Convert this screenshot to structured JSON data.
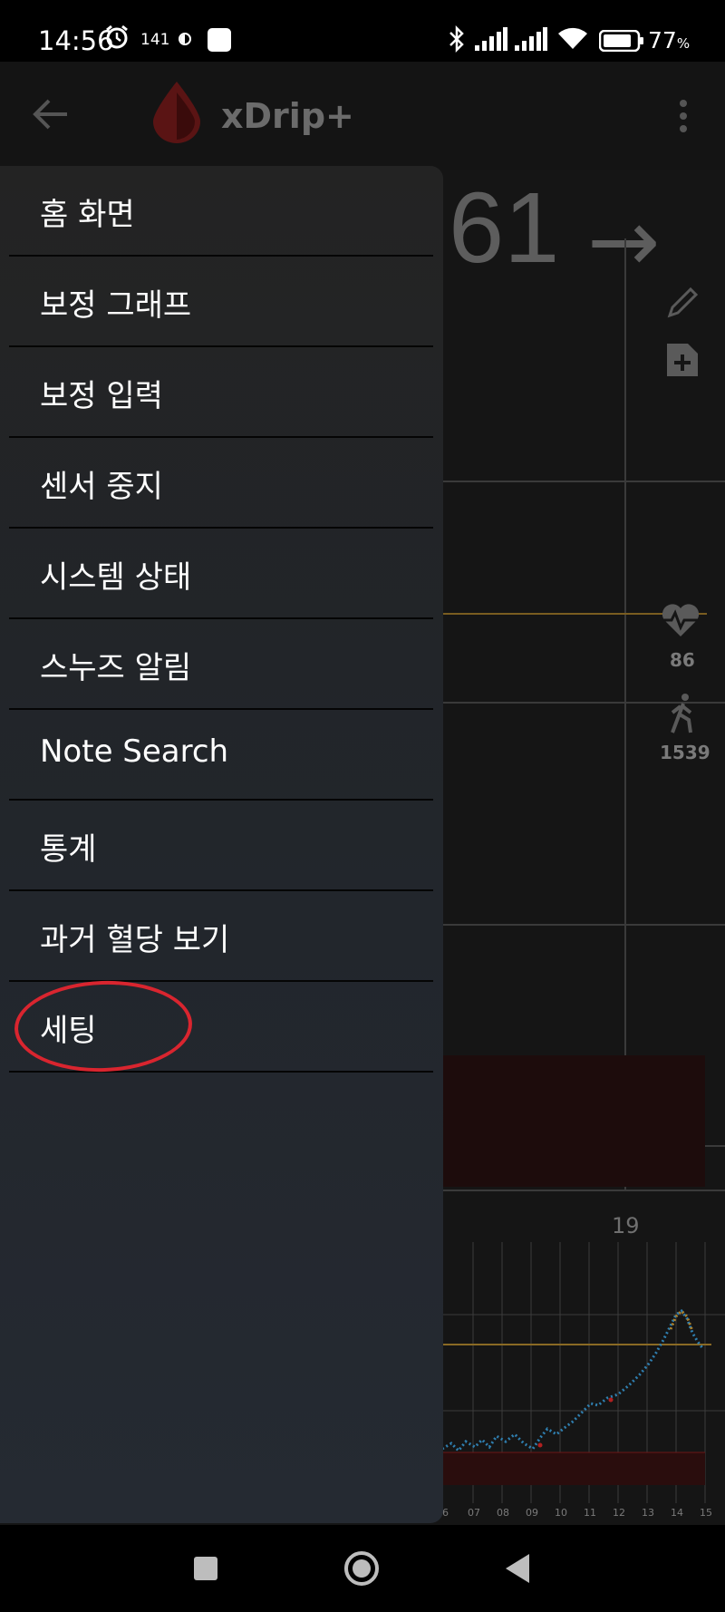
{
  "status_bar": {
    "time": "14:56",
    "notification_count": "141",
    "battery_percent": "77",
    "battery_unit": "%"
  },
  "toolbar": {
    "title": "xDrip+"
  },
  "background": {
    "glucose_value": "61",
    "trend_arrow": "→",
    "heart_rate": "86",
    "steps": "1539",
    "axis_hour_label": "19",
    "mini_axis_labels": [
      "6",
      "07",
      "08",
      "09",
      "10",
      "11",
      "12",
      "13",
      "14",
      "15"
    ]
  },
  "drawer": {
    "items": [
      {
        "label": "홈 화면"
      },
      {
        "label": "보정 그래프"
      },
      {
        "label": "보정 입력"
      },
      {
        "label": "센서 중지"
      },
      {
        "label": "시스템 상태"
      },
      {
        "label": "스누즈 알림"
      },
      {
        "label": "Note Search"
      },
      {
        "label": "통계"
      },
      {
        "label": "과거 혈당 보기"
      },
      {
        "label": "세팅"
      }
    ]
  },
  "colors": {
    "highlight_circle": "#d9252f",
    "high_line": "#b0832b",
    "low_zone": "#2a0d0d",
    "readings": "#2f7fb0"
  }
}
